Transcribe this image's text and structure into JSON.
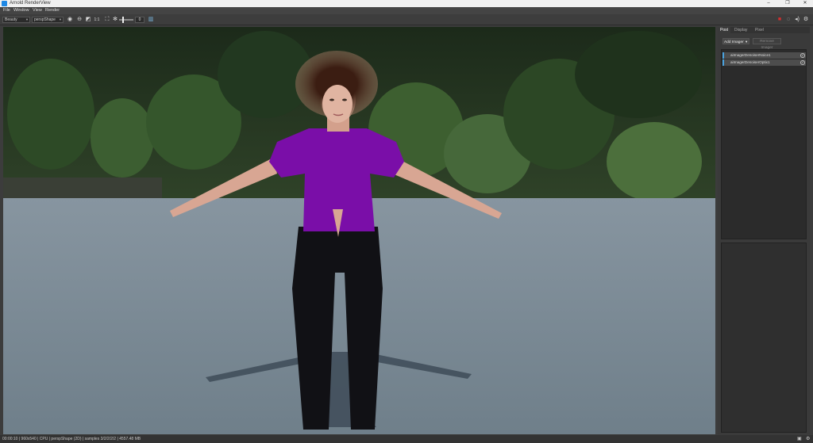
{
  "window": {
    "title": "Arnold RenderView",
    "minimize": "–",
    "maximize": "❐",
    "close": "✕"
  },
  "menu": [
    "File",
    "Window",
    "View",
    "Render"
  ],
  "toolbar": {
    "aov_value": "Beauty",
    "camera_value": "perspShape",
    "exposure_value": "0",
    "exposure_fraction": 0.3
  },
  "sidepanel": {
    "tabs": [
      "Post",
      "Display",
      "Pixel"
    ],
    "active_tab": "Post",
    "add_imager": "Add Imager",
    "remove_imager": "Remove Imager",
    "imagers": [
      {
        "label": "aiImagerDenoiserNoice1",
        "checked": "✓"
      },
      {
        "label": "aiImagerDenoiserOptix1",
        "checked": "✓"
      }
    ]
  },
  "status": {
    "text": "00:00:10 | 960x540 | CPU | perspShape (2D) | samples 3/2/2/2/2 | 4557.48 MB"
  },
  "colors": {
    "accent": "#4aa3df",
    "record": "#d32f2f",
    "shirt": "#7a0ea8",
    "pants": "#111115",
    "floor": "#7d8c96"
  }
}
